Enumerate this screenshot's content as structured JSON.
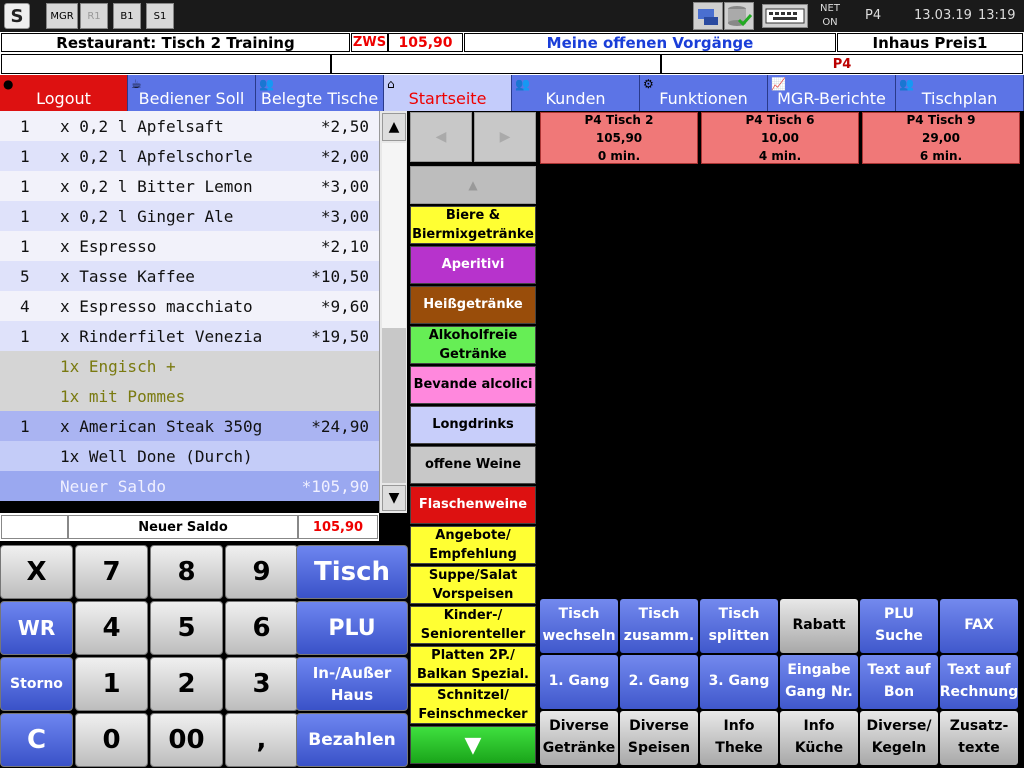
{
  "topbar": {
    "buttons": [
      "MGR",
      "R1",
      "B1",
      "S1"
    ],
    "net_line1": "NET",
    "net_line2": "ON",
    "printer": "P4",
    "date": "13.03.19",
    "time": "13:19"
  },
  "info": {
    "restaurant": "Restaurant:  Tisch  2   Training",
    "zws_label": "ZWS",
    "zws_value": "105,90",
    "open_tasks": "Meine offenen Vorgänge",
    "price_level": "Inhaus Preis1",
    "second_right": "P4"
  },
  "tabs": [
    {
      "label": "Logout",
      "icon": "logout-icon",
      "color": "#dd1111"
    },
    {
      "label": "Bediener Soll",
      "icon": "waiter-icon",
      "color": "#5c74e6"
    },
    {
      "label": "Belegte Tische",
      "icon": "people-icon",
      "color": "#5c74e6"
    },
    {
      "label": "Startseite",
      "icon": "home-icon",
      "color": "#b9c3fa"
    },
    {
      "label": "Kunden",
      "icon": "people-icon",
      "color": "#5c74e6"
    },
    {
      "label": "Funktionen",
      "icon": "gears-icon",
      "color": "#5c74e6"
    },
    {
      "label": "MGR-Berichte",
      "icon": "chart-icon",
      "color": "#5c74e6"
    },
    {
      "label": "Tischplan",
      "icon": "people-icon",
      "color": "#5c74e6"
    }
  ],
  "order": {
    "items": [
      {
        "qty": "1",
        "name": "x 0,2 l Apfelsaft",
        "price": "*2,50"
      },
      {
        "qty": "1",
        "name": "x 0,2 l Apfelschorle",
        "price": "*2,00"
      },
      {
        "qty": "1",
        "name": "x 0,2 l Bitter Lemon",
        "price": "*3,00"
      },
      {
        "qty": "1",
        "name": "x 0,2 l Ginger Ale",
        "price": "*3,00"
      },
      {
        "qty": "1",
        "name": "x Espresso",
        "price": "*2,10"
      },
      {
        "qty": "5",
        "name": "x Tasse Kaffee",
        "price": "*10,50"
      },
      {
        "qty": "4",
        "name": "x Espresso macchiato",
        "price": "*9,60"
      },
      {
        "qty": "1",
        "name": "x Rinderfilet Venezia",
        "price": "*19,50"
      },
      {
        "qty": "",
        "name": "1x Engisch +",
        "price": ""
      },
      {
        "qty": "",
        "name": "1x mit Pommes",
        "price": ""
      },
      {
        "qty": "1",
        "name": "x American Steak 350g",
        "price": "*24,90"
      },
      {
        "qty": "",
        "name": "1x Well Done (Durch)",
        "price": ""
      },
      {
        "qty": "",
        "name": "Neuer Saldo",
        "price": "*105,90"
      }
    ],
    "saldo_label": "Neuer Saldo",
    "saldo_value": "105,90"
  },
  "keypad": {
    "keys": [
      "X",
      "7",
      "8",
      "9",
      "WR",
      "4",
      "5",
      "6",
      "Storno",
      "1",
      "2",
      "3",
      "C",
      "0",
      "00",
      ","
    ],
    "actions": [
      "Tisch",
      "PLU",
      "In-/Außer Haus",
      "Bezahlen"
    ]
  },
  "categories": [
    {
      "label": "Biere & Biermixgetränke",
      "color": "#ffff33"
    },
    {
      "label": "Aperitivi",
      "color": "#b733cc"
    },
    {
      "label": "Heißgetränke",
      "color": "#994d0a"
    },
    {
      "label": "Alkoholfreie Getränke",
      "color": "#66ee55"
    },
    {
      "label": "Bevande alcolici",
      "color": "#ff88dd"
    },
    {
      "label": "Longdrinks",
      "color": "#c8cefa"
    },
    {
      "label": "offene Weine",
      "color": "#c8c8c8"
    },
    {
      "label": "Flaschenweine",
      "color": "#dd1111"
    },
    {
      "label": "Angebote/ Empfehlung",
      "color": "#ffff33"
    },
    {
      "label": "Suppe/Salat Vorspeisen",
      "color": "#ffff33"
    },
    {
      "label": "Kinder-/ Seniorenteller",
      "color": "#ffff33"
    },
    {
      "label": "Platten 2P./ Balkan Spezial.",
      "color": "#ffff33"
    },
    {
      "label": "Schnitzel/ Feinschmecker",
      "color": "#ffff33"
    }
  ],
  "tables": [
    {
      "title": "P4   Tisch 2",
      "amount": "105,90",
      "time": "0 min."
    },
    {
      "title": "P4   Tisch 6",
      "amount": "10,00",
      "time": "4 min."
    },
    {
      "title": "P4   Tisch 9",
      "amount": "29,00",
      "time": "6 min."
    }
  ],
  "functions": [
    {
      "label": "Tisch wechseln",
      "style": "b"
    },
    {
      "label": "Tisch zusamm.",
      "style": "b"
    },
    {
      "label": "Tisch splitten",
      "style": "b"
    },
    {
      "label": "Rabatt",
      "style": "g"
    },
    {
      "label": "PLU Suche",
      "style": "b"
    },
    {
      "label": "FAX",
      "style": "b"
    },
    {
      "label": "1. Gang",
      "style": "b"
    },
    {
      "label": "2. Gang",
      "style": "b"
    },
    {
      "label": "3. Gang",
      "style": "b"
    },
    {
      "label": "Eingabe Gang Nr.",
      "style": "b"
    },
    {
      "label": "Text auf Bon",
      "style": "b"
    },
    {
      "label": "Text auf Rechnung",
      "style": "b"
    },
    {
      "label": "Diverse Getränke",
      "style": "g"
    },
    {
      "label": "Diverse Speisen",
      "style": "g"
    },
    {
      "label": "Info Theke",
      "style": "g"
    },
    {
      "label": "Info Küche",
      "style": "g"
    },
    {
      "label": "Diverse/ Kegeln",
      "style": "g"
    },
    {
      "label": "Zusatz- texte",
      "style": "g"
    }
  ]
}
